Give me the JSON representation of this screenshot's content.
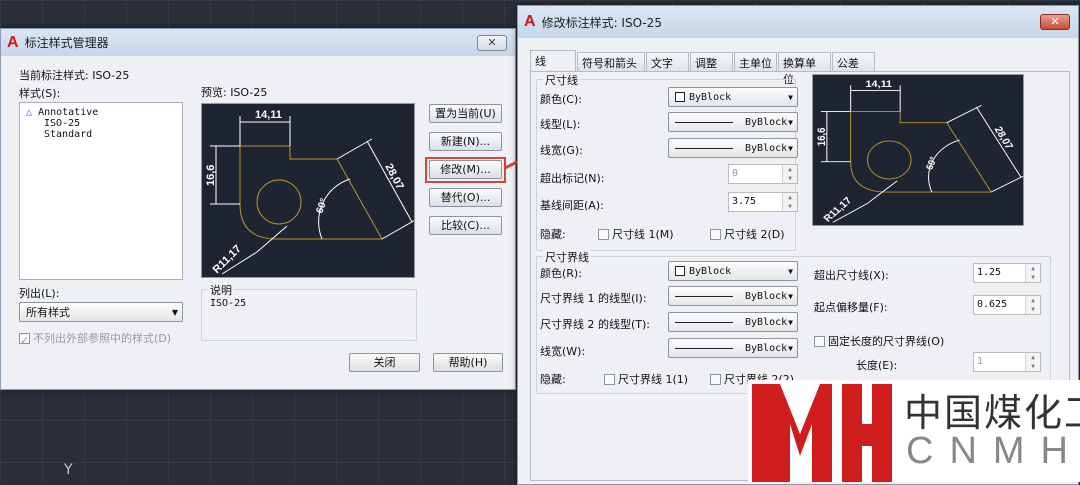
{
  "manager": {
    "title": "标注样式管理器",
    "current_label": "当前标注样式: ISO-25",
    "styles_label": "样式(S):",
    "styles": [
      "Annotative",
      "ISO-25",
      "Standard"
    ],
    "preview_label": "预览: ISO-25",
    "buttons": [
      "置为当前(U)",
      "新建(N)...",
      "修改(M)...",
      "替代(O)...",
      "比较(C)..."
    ],
    "list_label": "列出(L):",
    "list_value": "所有样式",
    "xref_checkbox": "不列出外部参照中的样式(D)",
    "desc_label": "说明",
    "desc_value": "ISO-25",
    "close": "关闭",
    "help": "帮助(H)",
    "close_x": "✕"
  },
  "preview_dims": {
    "top": "14,11",
    "left": "16,6",
    "diag": "28,07",
    "angle": "60°",
    "radius": "R11,17"
  },
  "modify": {
    "title": "修改标注样式: ISO-25",
    "close_x": "✕",
    "tabs": [
      "线",
      "符号和箭头",
      "文字",
      "调整",
      "主单位",
      "换算单位",
      "公差"
    ],
    "dimline": {
      "group": "尺寸线",
      "color_label": "颜色(C):",
      "color_value": "ByBlock",
      "ltype_label": "线型(L):",
      "ltype_value": "ByBlock",
      "lweight_label": "线宽(G):",
      "lweight_value": "ByBlock",
      "ext_label": "超出标记(N):",
      "ext_value": "0",
      "base_label": "基线间距(A):",
      "base_value": "3.75",
      "hide_label": "隐藏:",
      "hide1": "尺寸线 1(M)",
      "hide2": "尺寸线 2(D)"
    },
    "extline": {
      "group": "尺寸界线",
      "color_label": "颜色(R):",
      "color_value": "ByBlock",
      "lt1_label": "尺寸界线 1 的线型(I):",
      "lt1_value": "ByBlock",
      "lt2_label": "尺寸界线 2 的线型(T):",
      "lt2_value": "ByBlock",
      "lw_label": "线宽(W):",
      "lw_value": "ByBlock",
      "hide_label": "隐藏:",
      "hide1": "尺寸界线 1(1)",
      "hide2": "尺寸界线 2(2)",
      "beyond_label": "超出尺寸线(X):",
      "beyond_value": "1.25",
      "offset_label": "起点偏移量(F):",
      "offset_value": "0.625",
      "fixed_label": "固定长度的尺寸界线(O)",
      "length_label": "长度(E):",
      "length_value": "1"
    }
  },
  "watermark": {
    "cn": "中国煤化工",
    "en": "CNMHG",
    "logo": "MH"
  },
  "cad": {
    "axis_y": "Y"
  }
}
